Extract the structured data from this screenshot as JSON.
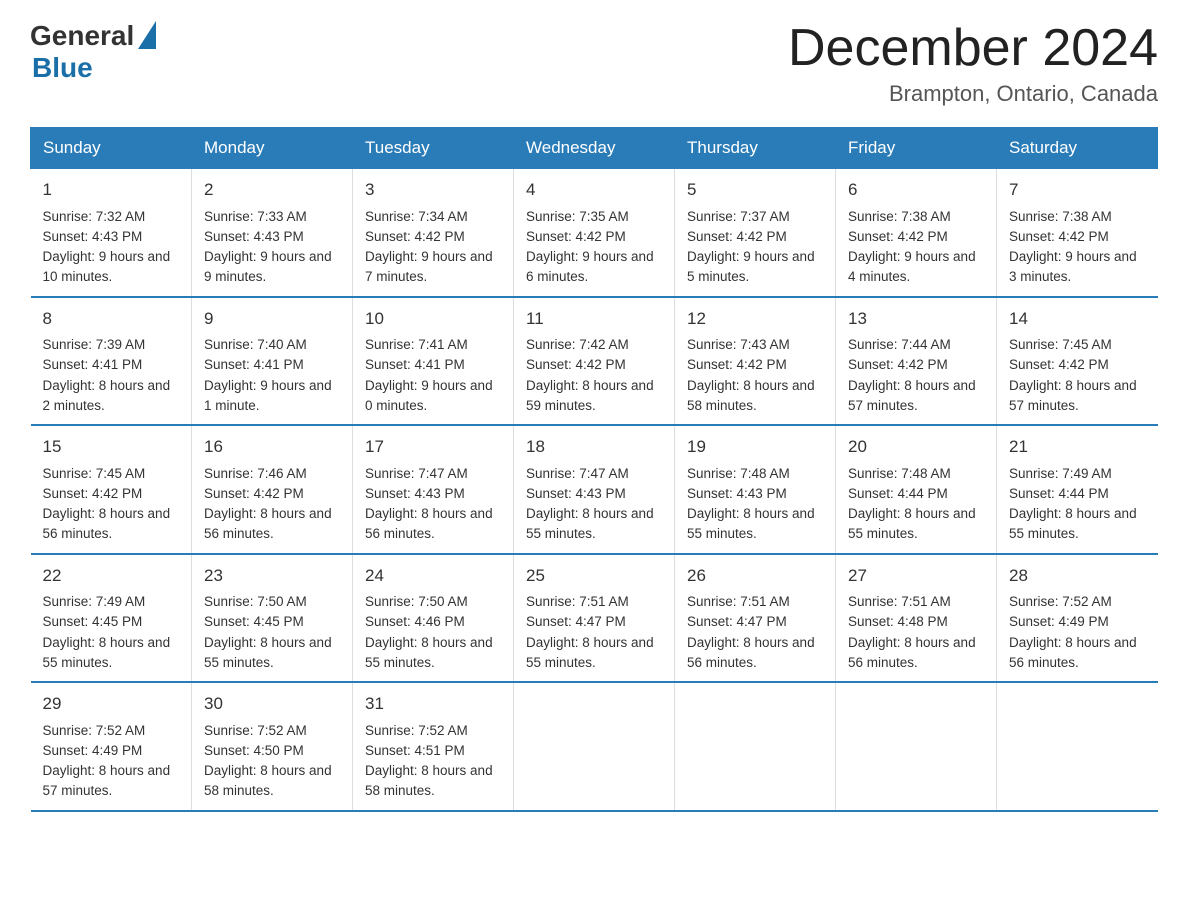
{
  "logo": {
    "general": "General",
    "blue": "Blue"
  },
  "title": "December 2024",
  "location": "Brampton, Ontario, Canada",
  "days_of_week": [
    "Sunday",
    "Monday",
    "Tuesday",
    "Wednesday",
    "Thursday",
    "Friday",
    "Saturday"
  ],
  "weeks": [
    [
      {
        "day": "1",
        "sunrise": "7:32 AM",
        "sunset": "4:43 PM",
        "daylight": "9 hours and 10 minutes."
      },
      {
        "day": "2",
        "sunrise": "7:33 AM",
        "sunset": "4:43 PM",
        "daylight": "9 hours and 9 minutes."
      },
      {
        "day": "3",
        "sunrise": "7:34 AM",
        "sunset": "4:42 PM",
        "daylight": "9 hours and 7 minutes."
      },
      {
        "day": "4",
        "sunrise": "7:35 AM",
        "sunset": "4:42 PM",
        "daylight": "9 hours and 6 minutes."
      },
      {
        "day": "5",
        "sunrise": "7:37 AM",
        "sunset": "4:42 PM",
        "daylight": "9 hours and 5 minutes."
      },
      {
        "day": "6",
        "sunrise": "7:38 AM",
        "sunset": "4:42 PM",
        "daylight": "9 hours and 4 minutes."
      },
      {
        "day": "7",
        "sunrise": "7:38 AM",
        "sunset": "4:42 PM",
        "daylight": "9 hours and 3 minutes."
      }
    ],
    [
      {
        "day": "8",
        "sunrise": "7:39 AM",
        "sunset": "4:41 PM",
        "daylight": "8 hours and 2 minutes."
      },
      {
        "day": "9",
        "sunrise": "7:40 AM",
        "sunset": "4:41 PM",
        "daylight": "9 hours and 1 minute."
      },
      {
        "day": "10",
        "sunrise": "7:41 AM",
        "sunset": "4:41 PM",
        "daylight": "9 hours and 0 minutes."
      },
      {
        "day": "11",
        "sunrise": "7:42 AM",
        "sunset": "4:42 PM",
        "daylight": "8 hours and 59 minutes."
      },
      {
        "day": "12",
        "sunrise": "7:43 AM",
        "sunset": "4:42 PM",
        "daylight": "8 hours and 58 minutes."
      },
      {
        "day": "13",
        "sunrise": "7:44 AM",
        "sunset": "4:42 PM",
        "daylight": "8 hours and 57 minutes."
      },
      {
        "day": "14",
        "sunrise": "7:45 AM",
        "sunset": "4:42 PM",
        "daylight": "8 hours and 57 minutes."
      }
    ],
    [
      {
        "day": "15",
        "sunrise": "7:45 AM",
        "sunset": "4:42 PM",
        "daylight": "8 hours and 56 minutes."
      },
      {
        "day": "16",
        "sunrise": "7:46 AM",
        "sunset": "4:42 PM",
        "daylight": "8 hours and 56 minutes."
      },
      {
        "day": "17",
        "sunrise": "7:47 AM",
        "sunset": "4:43 PM",
        "daylight": "8 hours and 56 minutes."
      },
      {
        "day": "18",
        "sunrise": "7:47 AM",
        "sunset": "4:43 PM",
        "daylight": "8 hours and 55 minutes."
      },
      {
        "day": "19",
        "sunrise": "7:48 AM",
        "sunset": "4:43 PM",
        "daylight": "8 hours and 55 minutes."
      },
      {
        "day": "20",
        "sunrise": "7:48 AM",
        "sunset": "4:44 PM",
        "daylight": "8 hours and 55 minutes."
      },
      {
        "day": "21",
        "sunrise": "7:49 AM",
        "sunset": "4:44 PM",
        "daylight": "8 hours and 55 minutes."
      }
    ],
    [
      {
        "day": "22",
        "sunrise": "7:49 AM",
        "sunset": "4:45 PM",
        "daylight": "8 hours and 55 minutes."
      },
      {
        "day": "23",
        "sunrise": "7:50 AM",
        "sunset": "4:45 PM",
        "daylight": "8 hours and 55 minutes."
      },
      {
        "day": "24",
        "sunrise": "7:50 AM",
        "sunset": "4:46 PM",
        "daylight": "8 hours and 55 minutes."
      },
      {
        "day": "25",
        "sunrise": "7:51 AM",
        "sunset": "4:47 PM",
        "daylight": "8 hours and 55 minutes."
      },
      {
        "day": "26",
        "sunrise": "7:51 AM",
        "sunset": "4:47 PM",
        "daylight": "8 hours and 56 minutes."
      },
      {
        "day": "27",
        "sunrise": "7:51 AM",
        "sunset": "4:48 PM",
        "daylight": "8 hours and 56 minutes."
      },
      {
        "day": "28",
        "sunrise": "7:52 AM",
        "sunset": "4:49 PM",
        "daylight": "8 hours and 56 minutes."
      }
    ],
    [
      {
        "day": "29",
        "sunrise": "7:52 AM",
        "sunset": "4:49 PM",
        "daylight": "8 hours and 57 minutes."
      },
      {
        "day": "30",
        "sunrise": "7:52 AM",
        "sunset": "4:50 PM",
        "daylight": "8 hours and 58 minutes."
      },
      {
        "day": "31",
        "sunrise": "7:52 AM",
        "sunset": "4:51 PM",
        "daylight": "8 hours and 58 minutes."
      },
      null,
      null,
      null,
      null
    ]
  ]
}
